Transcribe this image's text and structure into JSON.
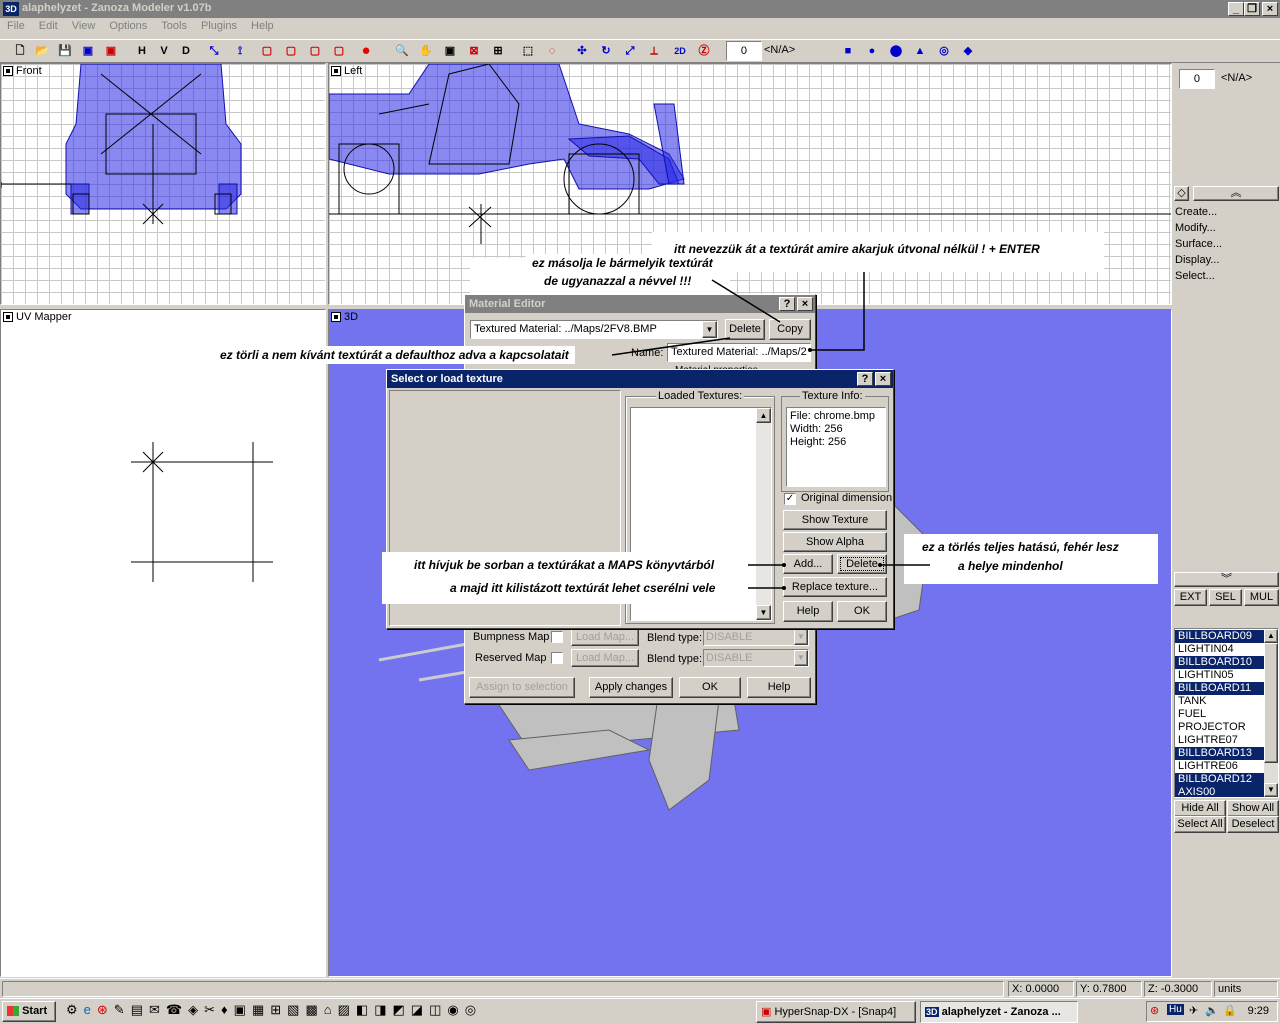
{
  "window": {
    "title": "alaphelyzet - Zanoza Modeler v1.07b",
    "app_icon": "3D"
  },
  "menu": [
    "File",
    "Edit",
    "View",
    "Options",
    "Tools",
    "Plugins",
    "Help"
  ],
  "toolbar": {
    "h": "H",
    "v": "V",
    "d": "D",
    "frame_value": "0",
    "frame_label": "<N/A>"
  },
  "viewports": {
    "front": "Front",
    "left": "Left",
    "uv": "UV Mapper",
    "threed": "3D"
  },
  "right_panel": {
    "frame_value": "0",
    "frame_label": "<N/A>",
    "menu": [
      "Create...",
      "Modify...",
      "Surface...",
      "Display...",
      "Select..."
    ],
    "mode_buttons": [
      "EXT",
      "SEL",
      "MUL"
    ],
    "objects": [
      {
        "name": "BILLBOARD09",
        "selected": true
      },
      {
        "name": "LIGHTIN04",
        "selected": false
      },
      {
        "name": "BILLBOARD10",
        "selected": true
      },
      {
        "name": "LIGHTIN05",
        "selected": false
      },
      {
        "name": "BILLBOARD11",
        "selected": true
      },
      {
        "name": "TANK",
        "selected": false
      },
      {
        "name": "FUEL",
        "selected": false
      },
      {
        "name": "PROJECTOR",
        "selected": false
      },
      {
        "name": "LIGHTRE07",
        "selected": false
      },
      {
        "name": "BILLBOARD13",
        "selected": true
      },
      {
        "name": "LIGHTRE06",
        "selected": false
      },
      {
        "name": "BILLBOARD12",
        "selected": true
      },
      {
        "name": "AXIS00",
        "selected": true
      }
    ],
    "hide_all": "Hide All",
    "show_all": "Show All",
    "select_all": "Select All",
    "deselect": "Deselect"
  },
  "material_editor": {
    "title": "Material Editor",
    "material_select": "Textured Material: ../Maps/2FV8.BMP",
    "delete": "Delete",
    "copy": "Copy",
    "name_label": "Name:",
    "name_value": "Textured Material: ../Maps/2",
    "props_label": "Material properties",
    "bump_label": "Bumpness Map",
    "reserved_label": "Reserved Map",
    "load_map": "Load Map...",
    "blend_label": "Blend type:",
    "blend_value": "DISABLE",
    "assign": "Assign to selection",
    "apply": "Apply changes",
    "ok": "OK",
    "help": "Help"
  },
  "texture_dialog": {
    "title": "Select or load texture",
    "loaded_label": "Loaded Textures:",
    "info_label": "Texture Info:",
    "info_file": "File: chrome.bmp",
    "info_width": "Width:  256",
    "info_height": "Height:  256",
    "original_dim": "Original dimension",
    "show_texture": "Show Texture",
    "show_alpha": "Show Alpha",
    "add": "Add...",
    "delete": "Delete",
    "replace": "Replace texture...",
    "help": "Help",
    "ok": "OK"
  },
  "annotations": {
    "rename": "itt nevezzük át a textúrát amire akarjuk útvonal nélkül ! + ENTER",
    "copy1": "ez másolja le bármelyik textúrát",
    "copy2": "de ugyanazzal a névvel !!!",
    "delete_default": "ez törli a nem kívánt textúrát a defaulthoz adva a kapcsolatait",
    "add_maps": "itt hívjuk be sorban a textúrákat a MAPS könyvtárból",
    "replace": "a majd itt kilistázott textúrát lehet cserélni vele",
    "full_delete1": "ez a törlés teljes hatású, fehér lesz",
    "full_delete2": "a helye mindenhol"
  },
  "status": {
    "x": "X: 0.0000",
    "y": "Y: 0.7800",
    "z": "Z: -0.3000",
    "units": "units"
  },
  "taskbar": {
    "start": "Start",
    "task1": "HyperSnap-DX - [Snap4]",
    "task2": "alaphelyzet - Zanoza ...",
    "lang": "Hu",
    "clock": "9:29"
  },
  "colors": {
    "title_active": "#0a246a",
    "title_inactive": "#808080",
    "viewport_3d": "#7373f0",
    "wire_blue": "#2222dd",
    "selection": "#0a246a"
  }
}
